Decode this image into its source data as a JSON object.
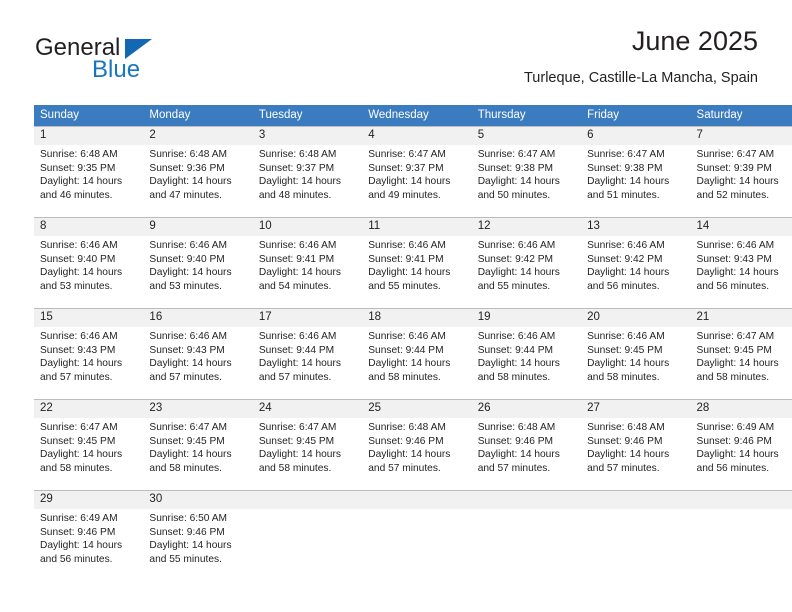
{
  "logo": {
    "primary_text": "General",
    "secondary_text": "Blue",
    "triangle_icon": "blue-triangle-icon",
    "primary_color": "#231f20",
    "secondary_color": "#1b75bc"
  },
  "header": {
    "title": "June 2025",
    "subtitle": "Turleque, Castille-La Mancha, Spain"
  },
  "theme": {
    "header_row_bg": "#3b7cc0",
    "header_row_text": "#ffffff",
    "daynum_bg": "#f1f1f1",
    "cell_border": "#b9b9b9",
    "body_text": "#231f20"
  },
  "calendar": {
    "weekday_headers": [
      "Sunday",
      "Monday",
      "Tuesday",
      "Wednesday",
      "Thursday",
      "Friday",
      "Saturday"
    ],
    "weeks": [
      [
        {
          "day": "1",
          "sunrise": "Sunrise: 6:48 AM",
          "sunset": "Sunset: 9:35 PM",
          "daylight_line1": "Daylight: 14 hours",
          "daylight_line2": "and 46 minutes."
        },
        {
          "day": "2",
          "sunrise": "Sunrise: 6:48 AM",
          "sunset": "Sunset: 9:36 PM",
          "daylight_line1": "Daylight: 14 hours",
          "daylight_line2": "and 47 minutes."
        },
        {
          "day": "3",
          "sunrise": "Sunrise: 6:48 AM",
          "sunset": "Sunset: 9:37 PM",
          "daylight_line1": "Daylight: 14 hours",
          "daylight_line2": "and 48 minutes."
        },
        {
          "day": "4",
          "sunrise": "Sunrise: 6:47 AM",
          "sunset": "Sunset: 9:37 PM",
          "daylight_line1": "Daylight: 14 hours",
          "daylight_line2": "and 49 minutes."
        },
        {
          "day": "5",
          "sunrise": "Sunrise: 6:47 AM",
          "sunset": "Sunset: 9:38 PM",
          "daylight_line1": "Daylight: 14 hours",
          "daylight_line2": "and 50 minutes."
        },
        {
          "day": "6",
          "sunrise": "Sunrise: 6:47 AM",
          "sunset": "Sunset: 9:38 PM",
          "daylight_line1": "Daylight: 14 hours",
          "daylight_line2": "and 51 minutes."
        },
        {
          "day": "7",
          "sunrise": "Sunrise: 6:47 AM",
          "sunset": "Sunset: 9:39 PM",
          "daylight_line1": "Daylight: 14 hours",
          "daylight_line2": "and 52 minutes."
        }
      ],
      [
        {
          "day": "8",
          "sunrise": "Sunrise: 6:46 AM",
          "sunset": "Sunset: 9:40 PM",
          "daylight_line1": "Daylight: 14 hours",
          "daylight_line2": "and 53 minutes."
        },
        {
          "day": "9",
          "sunrise": "Sunrise: 6:46 AM",
          "sunset": "Sunset: 9:40 PM",
          "daylight_line1": "Daylight: 14 hours",
          "daylight_line2": "and 53 minutes."
        },
        {
          "day": "10",
          "sunrise": "Sunrise: 6:46 AM",
          "sunset": "Sunset: 9:41 PM",
          "daylight_line1": "Daylight: 14 hours",
          "daylight_line2": "and 54 minutes."
        },
        {
          "day": "11",
          "sunrise": "Sunrise: 6:46 AM",
          "sunset": "Sunset: 9:41 PM",
          "daylight_line1": "Daylight: 14 hours",
          "daylight_line2": "and 55 minutes."
        },
        {
          "day": "12",
          "sunrise": "Sunrise: 6:46 AM",
          "sunset": "Sunset: 9:42 PM",
          "daylight_line1": "Daylight: 14 hours",
          "daylight_line2": "and 55 minutes."
        },
        {
          "day": "13",
          "sunrise": "Sunrise: 6:46 AM",
          "sunset": "Sunset: 9:42 PM",
          "daylight_line1": "Daylight: 14 hours",
          "daylight_line2": "and 56 minutes."
        },
        {
          "day": "14",
          "sunrise": "Sunrise: 6:46 AM",
          "sunset": "Sunset: 9:43 PM",
          "daylight_line1": "Daylight: 14 hours",
          "daylight_line2": "and 56 minutes."
        }
      ],
      [
        {
          "day": "15",
          "sunrise": "Sunrise: 6:46 AM",
          "sunset": "Sunset: 9:43 PM",
          "daylight_line1": "Daylight: 14 hours",
          "daylight_line2": "and 57 minutes."
        },
        {
          "day": "16",
          "sunrise": "Sunrise: 6:46 AM",
          "sunset": "Sunset: 9:43 PM",
          "daylight_line1": "Daylight: 14 hours",
          "daylight_line2": "and 57 minutes."
        },
        {
          "day": "17",
          "sunrise": "Sunrise: 6:46 AM",
          "sunset": "Sunset: 9:44 PM",
          "daylight_line1": "Daylight: 14 hours",
          "daylight_line2": "and 57 minutes."
        },
        {
          "day": "18",
          "sunrise": "Sunrise: 6:46 AM",
          "sunset": "Sunset: 9:44 PM",
          "daylight_line1": "Daylight: 14 hours",
          "daylight_line2": "and 58 minutes."
        },
        {
          "day": "19",
          "sunrise": "Sunrise: 6:46 AM",
          "sunset": "Sunset: 9:44 PM",
          "daylight_line1": "Daylight: 14 hours",
          "daylight_line2": "and 58 minutes."
        },
        {
          "day": "20",
          "sunrise": "Sunrise: 6:46 AM",
          "sunset": "Sunset: 9:45 PM",
          "daylight_line1": "Daylight: 14 hours",
          "daylight_line2": "and 58 minutes."
        },
        {
          "day": "21",
          "sunrise": "Sunrise: 6:47 AM",
          "sunset": "Sunset: 9:45 PM",
          "daylight_line1": "Daylight: 14 hours",
          "daylight_line2": "and 58 minutes."
        }
      ],
      [
        {
          "day": "22",
          "sunrise": "Sunrise: 6:47 AM",
          "sunset": "Sunset: 9:45 PM",
          "daylight_line1": "Daylight: 14 hours",
          "daylight_line2": "and 58 minutes."
        },
        {
          "day": "23",
          "sunrise": "Sunrise: 6:47 AM",
          "sunset": "Sunset: 9:45 PM",
          "daylight_line1": "Daylight: 14 hours",
          "daylight_line2": "and 58 minutes."
        },
        {
          "day": "24",
          "sunrise": "Sunrise: 6:47 AM",
          "sunset": "Sunset: 9:45 PM",
          "daylight_line1": "Daylight: 14 hours",
          "daylight_line2": "and 58 minutes."
        },
        {
          "day": "25",
          "sunrise": "Sunrise: 6:48 AM",
          "sunset": "Sunset: 9:46 PM",
          "daylight_line1": "Daylight: 14 hours",
          "daylight_line2": "and 57 minutes."
        },
        {
          "day": "26",
          "sunrise": "Sunrise: 6:48 AM",
          "sunset": "Sunset: 9:46 PM",
          "daylight_line1": "Daylight: 14 hours",
          "daylight_line2": "and 57 minutes."
        },
        {
          "day": "27",
          "sunrise": "Sunrise: 6:48 AM",
          "sunset": "Sunset: 9:46 PM",
          "daylight_line1": "Daylight: 14 hours",
          "daylight_line2": "and 57 minutes."
        },
        {
          "day": "28",
          "sunrise": "Sunrise: 6:49 AM",
          "sunset": "Sunset: 9:46 PM",
          "daylight_line1": "Daylight: 14 hours",
          "daylight_line2": "and 56 minutes."
        }
      ],
      [
        {
          "day": "29",
          "sunrise": "Sunrise: 6:49 AM",
          "sunset": "Sunset: 9:46 PM",
          "daylight_line1": "Daylight: 14 hours",
          "daylight_line2": "and 56 minutes."
        },
        {
          "day": "30",
          "sunrise": "Sunrise: 6:50 AM",
          "sunset": "Sunset: 9:46 PM",
          "daylight_line1": "Daylight: 14 hours",
          "daylight_line2": "and 55 minutes."
        },
        {
          "day": "",
          "sunrise": "",
          "sunset": "",
          "daylight_line1": "",
          "daylight_line2": ""
        },
        {
          "day": "",
          "sunrise": "",
          "sunset": "",
          "daylight_line1": "",
          "daylight_line2": ""
        },
        {
          "day": "",
          "sunrise": "",
          "sunset": "",
          "daylight_line1": "",
          "daylight_line2": ""
        },
        {
          "day": "",
          "sunrise": "",
          "sunset": "",
          "daylight_line1": "",
          "daylight_line2": ""
        },
        {
          "day": "",
          "sunrise": "",
          "sunset": "",
          "daylight_line1": "",
          "daylight_line2": ""
        }
      ]
    ]
  }
}
